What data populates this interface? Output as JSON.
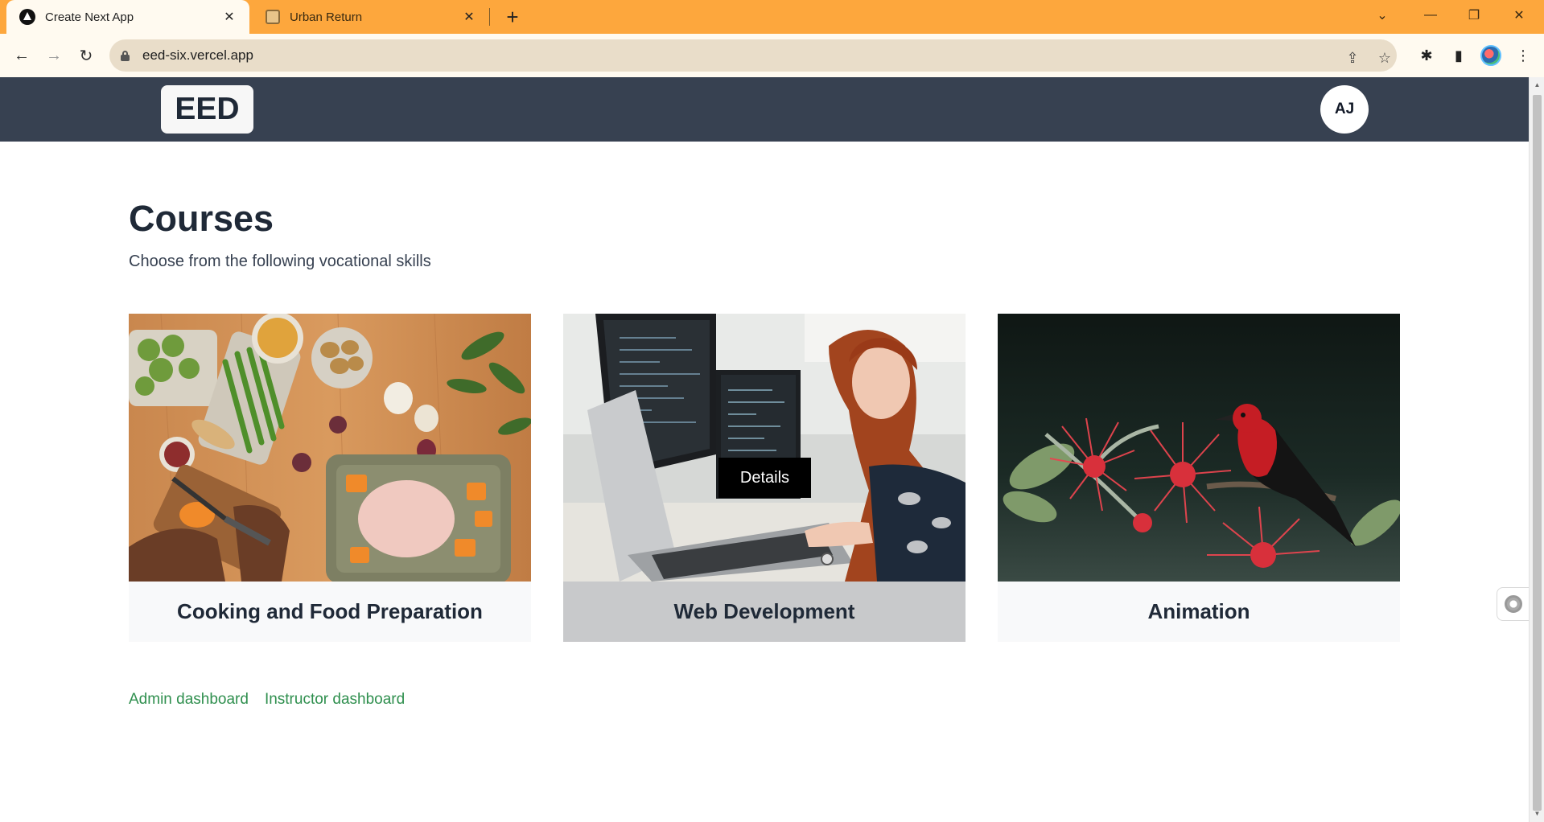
{
  "browser": {
    "tabs": [
      {
        "title": "Create Next App",
        "active": true,
        "icon": "nextjs-icon"
      },
      {
        "title": "Urban Return",
        "active": false,
        "icon": "urban-return-icon"
      }
    ],
    "url": "eed-six.vercel.app",
    "accent_color": "#fda73d"
  },
  "site": {
    "logo_text": "EED",
    "avatar_initials": "AJ",
    "header_color": "#374151"
  },
  "page": {
    "title": "Courses",
    "subtitle": "Choose from the following vocational skills"
  },
  "courses": [
    {
      "name": "Cooking and Food Preparation",
      "image": "cooking-photo"
    },
    {
      "name": "Web Development",
      "image": "web-development-photo",
      "hovered": true,
      "details_label": "Details"
    },
    {
      "name": "Animation",
      "image": "bird-flower-photo"
    }
  ],
  "footer_links": [
    {
      "label": "Admin dashboard"
    },
    {
      "label": "Instructor dashboard"
    }
  ],
  "link_color": "#2f8f4e"
}
